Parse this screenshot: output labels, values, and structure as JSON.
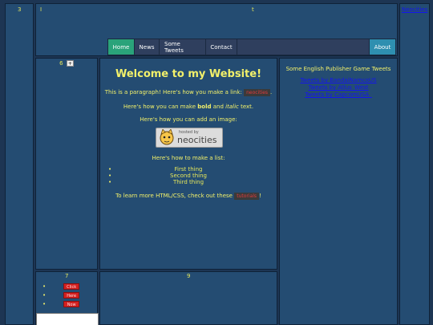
{
  "top_left_cell": {
    "number": "3"
  },
  "header": {
    "marker_left": "I",
    "marker_right": "t"
  },
  "top_right": {
    "link": "Neocities"
  },
  "nav": {
    "items": [
      {
        "label": "Home",
        "active": true
      },
      {
        "label": "News",
        "active": false
      },
      {
        "label": "Some Tweets",
        "active": false
      },
      {
        "label": "Contact",
        "active": false
      }
    ],
    "about": "About"
  },
  "left_panel": {
    "number": "6",
    "toggle": "+"
  },
  "main": {
    "title": "Welcome to my Website!",
    "para1_prefix": "This is a paragraph! Here's how you make a link:",
    "para1_link": "neocities",
    "para1_suffix": ".",
    "para2_prefix": "Here's how you can make",
    "para2_bold": "bold",
    "para2_mid": "and",
    "para2_italic": "italic",
    "para2_suffix": "text.",
    "para3": "Here's how you can add an image:",
    "image_badge_top": "hosted by",
    "image_badge_main": "neocities",
    "para4": "Here's how to make a list:",
    "list": [
      "First thing",
      "Second thing",
      "Third thing"
    ],
    "para5_prefix": "To learn more HTML/CSS, check out these",
    "para5_link": "tutorials",
    "para5_suffix": "!"
  },
  "right_panel": {
    "title": "Some English Publisher Game Tweets",
    "links": [
      "Tweets by BandaiNamcoUS",
      "Tweets by Atlus_West",
      "Tweets by CapcomUSA_"
    ]
  },
  "bottom_left": {
    "number": "7",
    "buttons": [
      "Click",
      "Here",
      "Now"
    ]
  },
  "bottom_center": {
    "number": "9"
  },
  "colors": {
    "background": "#1d3553",
    "panel": "#244c72",
    "text": "#f2f06a",
    "nav_active": "#2aa37a",
    "nav_about": "#2e8fb0",
    "link": "#1515ee"
  }
}
